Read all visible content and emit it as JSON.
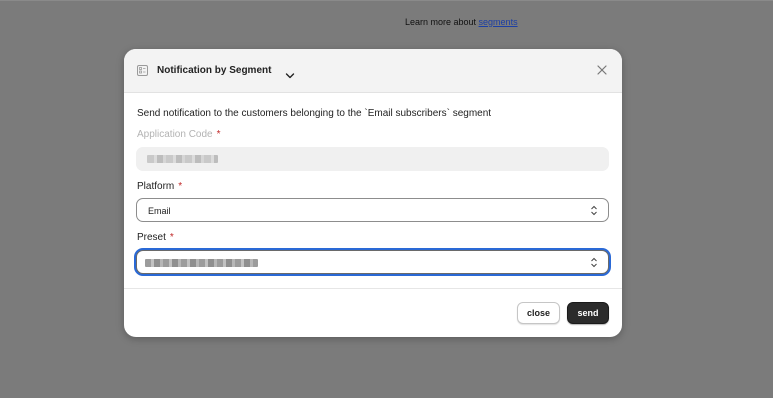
{
  "background": {
    "learn_more_text": "Learn more about ",
    "learn_more_link": "segments"
  },
  "modal": {
    "title": "Notification by Segment",
    "title_icon": "segment-icon",
    "close_icon": "close-icon",
    "description": "Send notification to the customers belonging to the `Email subscribers` segment",
    "fields": {
      "application_code": {
        "label": "Application Code",
        "required_mark": "*",
        "value_redacted": true
      },
      "platform": {
        "label": "Platform",
        "required_mark": "*",
        "value": "Email"
      },
      "preset": {
        "label": "Preset",
        "required_mark": "*",
        "value_redacted": true,
        "focused": true
      }
    },
    "buttons": {
      "close_label": "close",
      "send_label": "send"
    }
  },
  "colors": {
    "overlay": "#7b7b7b",
    "required": "#c02727",
    "focus_ring": "#2a69d6",
    "primary_button": "#2b2b2b",
    "link": "#1c3fa5"
  }
}
